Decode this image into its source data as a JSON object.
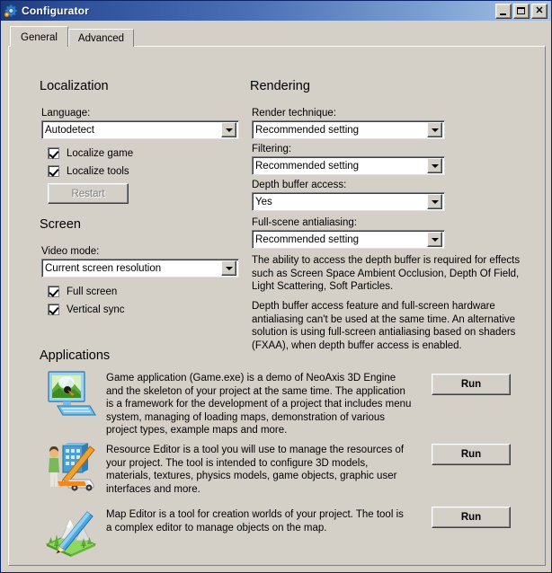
{
  "window": {
    "title": "Configurator",
    "icon": "gear-icon",
    "controls": {
      "minimize": "minimize-button",
      "maximize": "maximize-button",
      "close": "close-button"
    }
  },
  "tabs": [
    {
      "label": "General",
      "selected": true
    },
    {
      "label": "Advanced",
      "selected": false
    }
  ],
  "localization": {
    "title": "Localization",
    "language_label": "Language:",
    "language_value": "Autodetect",
    "localize_game_label": "Localize game",
    "localize_game_checked": true,
    "localize_tools_label": "Localize tools",
    "localize_tools_checked": true,
    "restart_label": "Restart",
    "restart_enabled": false
  },
  "screen": {
    "title": "Screen",
    "video_mode_label": "Video mode:",
    "video_mode_value": "Current screen resolution",
    "full_screen_label": "Full screen",
    "full_screen_checked": true,
    "vertical_sync_label": "Vertical sync",
    "vertical_sync_checked": true
  },
  "rendering": {
    "title": "Rendering",
    "render_technique_label": "Render technique:",
    "render_technique_value": "Recommended setting",
    "filtering_label": "Filtering:",
    "filtering_value": "Recommended setting",
    "depth_buffer_label": "Depth buffer access:",
    "depth_buffer_value": "Yes",
    "antialiasing_label": "Full-scene antialiasing:",
    "antialiasing_value": "Recommended setting",
    "note_1": "The ability to access the depth buffer is required for effects such as Screen Space Ambient Occlusion, Depth Of Field, Light Scattering, Soft Particles.",
    "note_2": "Depth buffer access feature and full-screen hardware antialiasing can't be used at the same time. An alternative solution is using full-screen antialiasing based on shaders (FXAA), when depth buffer access is enabled."
  },
  "applications": {
    "title": "Applications",
    "items": [
      {
        "icon": "game-monitor-icon",
        "description": "Game application (Game.exe) is a demo of NeoAxis 3D Engine and the skeleton of your project at the same time. The application is a framework for the development of a project that includes menu system, managing of loading maps, demonstration of various project types, example maps and more.",
        "button_label": "Run"
      },
      {
        "icon": "resource-editor-icon",
        "description": "Resource Editor is a tool you will use to manage the resources of your project. The tool is intended to configure 3D models, materials, textures, physics models, game objects, graphic user interfaces and more.",
        "button_label": "Run"
      },
      {
        "icon": "map-editor-icon",
        "description": "Map Editor is a tool for creation worlds of your project. The tool is a complex editor to manage objects on the map.",
        "button_label": "Run"
      }
    ]
  },
  "colors": {
    "face": "#d4d0c8",
    "title_gradient_start": "#1e3a78",
    "title_gradient_end": "#a8c4e6",
    "text": "#000000",
    "disabled_text": "#808080"
  }
}
